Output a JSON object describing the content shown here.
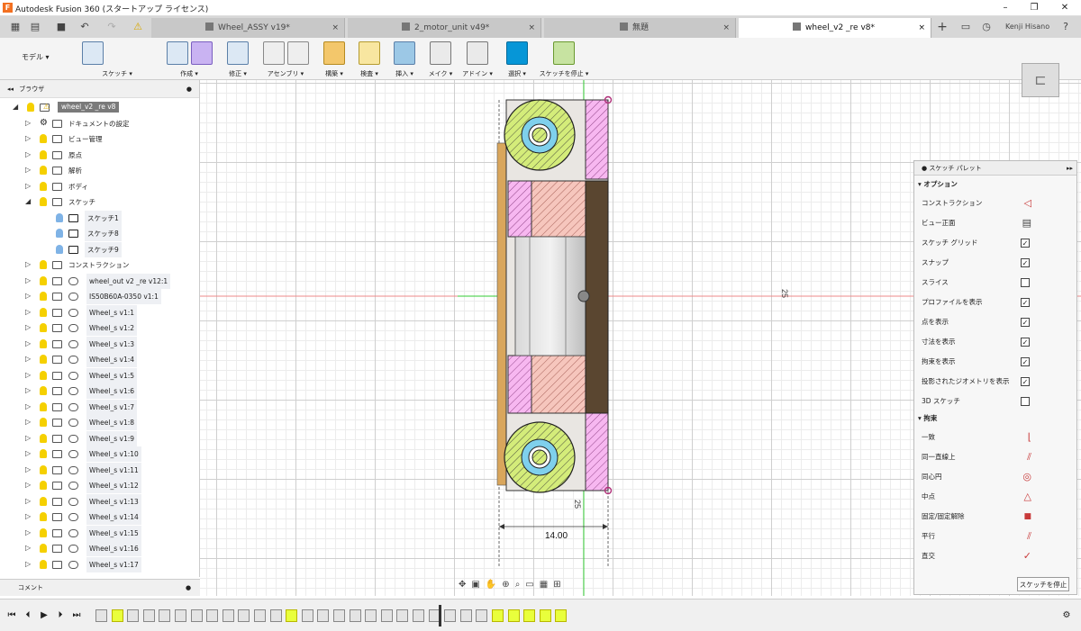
{
  "app": {
    "title": "Autodesk Fusion 360 (スタートアップ ライセンス)",
    "logo": "F",
    "user": "Kenji Hisano"
  },
  "tabs": [
    {
      "label": "Wheel_ASSY v19*",
      "close": "×"
    },
    {
      "label": "2_motor_unit v49*",
      "close": "×"
    },
    {
      "label": "無題",
      "close": "×"
    },
    {
      "label": "wheel_v2 _re v8*",
      "close": "×"
    }
  ],
  "toolbar": {
    "mode": "モデル ▾",
    "groups": [
      "スケッチ ▾",
      "作成 ▾",
      "修正 ▾",
      "アセンブリ ▾",
      "構築 ▾",
      "検査 ▾",
      "挿入 ▾",
      "メイク ▾",
      "アドイン ▾",
      "選択 ▾",
      "スケッチを停止 ▾"
    ]
  },
  "browser": {
    "title": "ブラウザ",
    "root": "wheel_v2 _re v8",
    "items": [
      "ドキュメントの設定",
      "ビュー管理",
      "原点",
      "解析",
      "ボディ",
      "スケッチ",
      "スケッチ1",
      "スケッチ8",
      "スケッチ9",
      "コンストラクション",
      "wheel_out v2 _re v12:1",
      "IS50B60A-0350 v1:1",
      "Wheel_s v1:1",
      "Wheel_s v1:2",
      "Wheel_s v1:3",
      "Wheel_s v1:4",
      "Wheel_s v1:5",
      "Wheel_s v1:6",
      "Wheel_s v1:7",
      "Wheel_s v1:8",
      "Wheel_s v1:9",
      "Wheel_s v1:10",
      "Wheel_s v1:11",
      "Wheel_s v1:12",
      "Wheel_s v1:13",
      "Wheel_s v1:14",
      "Wheel_s v1:15",
      "Wheel_s v1:16",
      "Wheel_s v1:17"
    ],
    "comment": "コメント"
  },
  "canvas": {
    "dim_width": "14.00",
    "dim_side": "25",
    "dim_small": "25"
  },
  "palette": {
    "title": "スケッチ パレット",
    "options_title": "オプション",
    "options": [
      {
        "label": "コンストラクション",
        "type": "icon",
        "icon": "construction-icon"
      },
      {
        "label": "ビュー正面",
        "type": "icon",
        "icon": "look-at-icon"
      },
      {
        "label": "スケッチ グリッド",
        "type": "check",
        "checked": true
      },
      {
        "label": "スナップ",
        "type": "check",
        "checked": true
      },
      {
        "label": "スライス",
        "type": "check",
        "checked": false
      },
      {
        "label": "プロファイルを表示",
        "type": "check",
        "checked": true
      },
      {
        "label": "点を表示",
        "type": "check",
        "checked": true
      },
      {
        "label": "寸法を表示",
        "type": "check",
        "checked": true
      },
      {
        "label": "拘束を表示",
        "type": "check",
        "checked": true
      },
      {
        "label": "投影されたジオメトリを表示",
        "type": "check",
        "checked": true
      },
      {
        "label": "3D スケッチ",
        "type": "check",
        "checked": false
      }
    ],
    "constraints_title": "拘束",
    "constraints": [
      {
        "label": "一致",
        "icon": "coincident-icon"
      },
      {
        "label": "同一直線上",
        "icon": "collinear-icon"
      },
      {
        "label": "同心円",
        "icon": "concentric-icon"
      },
      {
        "label": "中点",
        "icon": "midpoint-icon"
      },
      {
        "label": "固定/固定解除",
        "icon": "lock-icon"
      },
      {
        "label": "平行",
        "icon": "parallel-icon"
      },
      {
        "label": "直交",
        "icon": "perpendicular-icon"
      }
    ],
    "stop_button": "スケッチを停止"
  },
  "colors": {
    "accent": "#0696d7",
    "selected_timeline": "#e9ff3c",
    "hatch_green": "#d4ec7a",
    "hatch_pink": "#f7b7f0",
    "hatch_salmon": "#f6c6bd",
    "dark_body": "#5a4630"
  }
}
